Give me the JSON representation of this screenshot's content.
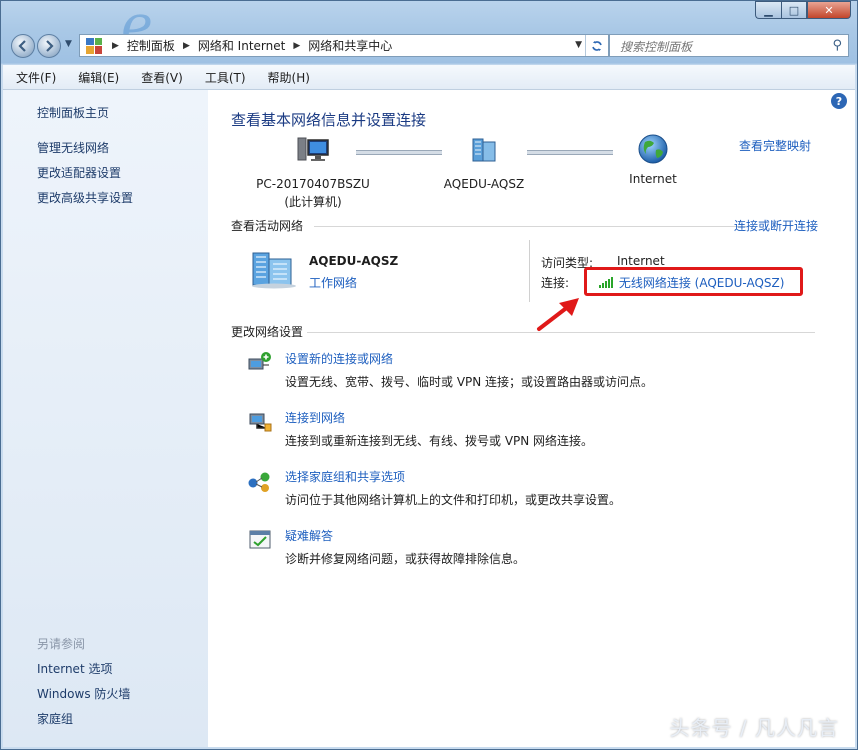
{
  "window": {
    "controls": {
      "minimize": "▁",
      "maximize": "□",
      "close": "✕"
    }
  },
  "address_bar": {
    "crumbs": [
      "控制面板",
      "网络和 Internet",
      "网络和共享中心"
    ],
    "search_placeholder": "搜索控制面板"
  },
  "menu": [
    "文件(F)",
    "编辑(E)",
    "查看(V)",
    "工具(T)",
    "帮助(H)"
  ],
  "sidebar": {
    "top_links": [
      "控制面板主页",
      "管理无线网络",
      "更改适配器设置",
      "更改高级共享设置"
    ],
    "see_also_label": "另请参阅",
    "see_also_links": [
      "Internet 选项",
      "Windows 防火墙",
      "家庭组"
    ]
  },
  "main": {
    "title": "查看基本网络信息并设置连接",
    "full_map_link": "查看完整映射",
    "map": {
      "computer_name": "PC-20170407BSZU",
      "computer_sub": "(此计算机)",
      "network_name": "AQEDU-AQSZ",
      "internet_label": "Internet"
    },
    "active_networks": {
      "heading": "查看活动网络",
      "connect_link": "连接或断开连接",
      "network_name": "AQEDU-AQSZ",
      "network_type": "工作网络",
      "access_type_label": "访问类型:",
      "access_type_value": "Internet",
      "connection_label": "连接:",
      "connection_value": "无线网络连接 (AQEDU-AQSZ)"
    },
    "change_settings": {
      "heading": "更改网络设置",
      "tasks": [
        {
          "link": "设置新的连接或网络",
          "desc": "设置无线、宽带、拨号、临时或 VPN 连接；或设置路由器或访问点。"
        },
        {
          "link": "连接到网络",
          "desc": "连接到或重新连接到无线、有线、拨号或 VPN 网络连接。"
        },
        {
          "link": "选择家庭组和共享选项",
          "desc": "访问位于其他网络计算机上的文件和打印机，或更改共享设置。"
        },
        {
          "link": "疑难解答",
          "desc": "诊断并修复网络问题，或获得故障排除信息。"
        }
      ]
    }
  },
  "watermark": "头条号 / 凡人凡言",
  "colors": {
    "link": "#1e5fbf",
    "title": "#1b3b83",
    "highlight": "#e01919"
  }
}
